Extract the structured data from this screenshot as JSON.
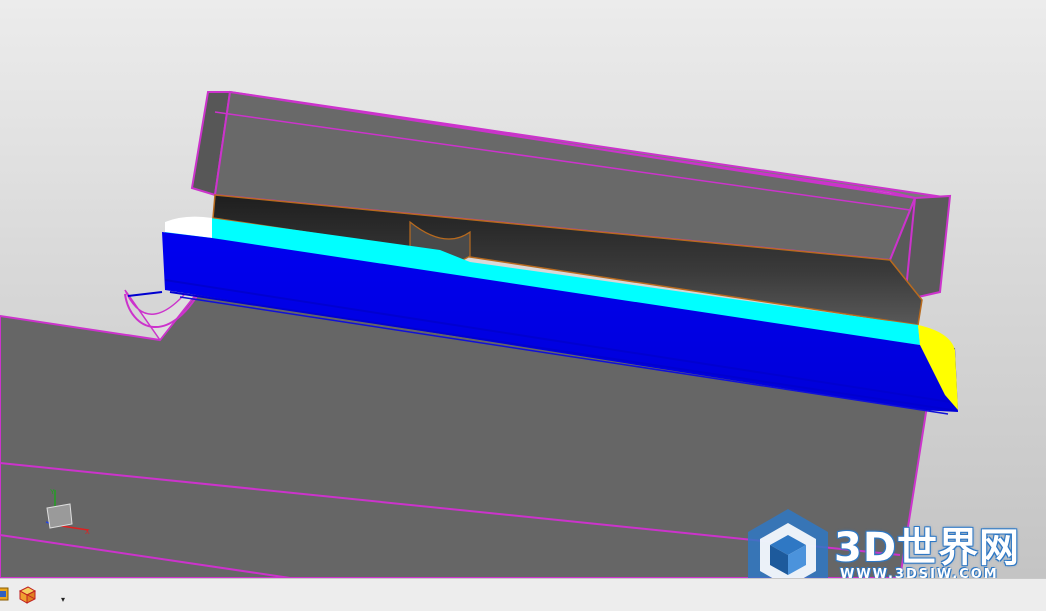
{
  "viewport": {
    "background_top": "#ececec",
    "background_bottom": "#c4c4c4"
  },
  "model": {
    "body_color": "#666666",
    "edge_color": "#cc33cc",
    "face_cyan": "#00ffff",
    "face_blue": "#0000ee",
    "face_yellow": "#ffff00",
    "groove_color": "#2a2a2a"
  },
  "triad": {
    "x_axis_color": "#e02020",
    "y_axis_color": "#20a020",
    "z_axis_color": "#2040e0"
  },
  "statusbar": {
    "buttons": [
      {
        "icon": "part-navigator-icon"
      },
      {
        "icon": "wireframe-cube-icon"
      }
    ],
    "dropdown_glyph": "▾"
  },
  "watermark": {
    "title": "3D世界网",
    "url": "WWW.3DSJW.COM",
    "logo_color": "#2f78c4"
  }
}
